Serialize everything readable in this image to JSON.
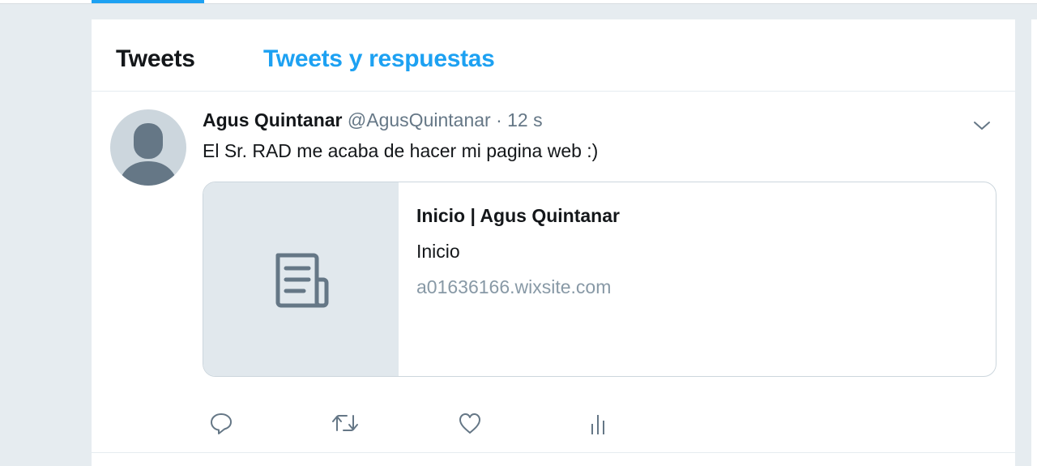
{
  "tabs": {
    "tweets_label": "Tweets",
    "replies_label": "Tweets y respuestas"
  },
  "tweet": {
    "author_name": "Agus Quintanar",
    "author_handle": "@AgusQuintanar",
    "separator": "·",
    "time": "12 s",
    "text": "El Sr. RAD me acaba de hacer mi pagina web :)",
    "card": {
      "title": "Inicio | Agus Quintanar",
      "description": "Inicio",
      "domain": "a01636166.wixsite.com",
      "thumb_icon": "document-icon"
    },
    "actions": [
      "reply-icon",
      "retweet-icon",
      "like-icon",
      "analytics-icon"
    ]
  },
  "colors": {
    "accent": "#1da1f2",
    "text": "#14171a",
    "muted": "#657786",
    "background": "#e6ecf0"
  }
}
